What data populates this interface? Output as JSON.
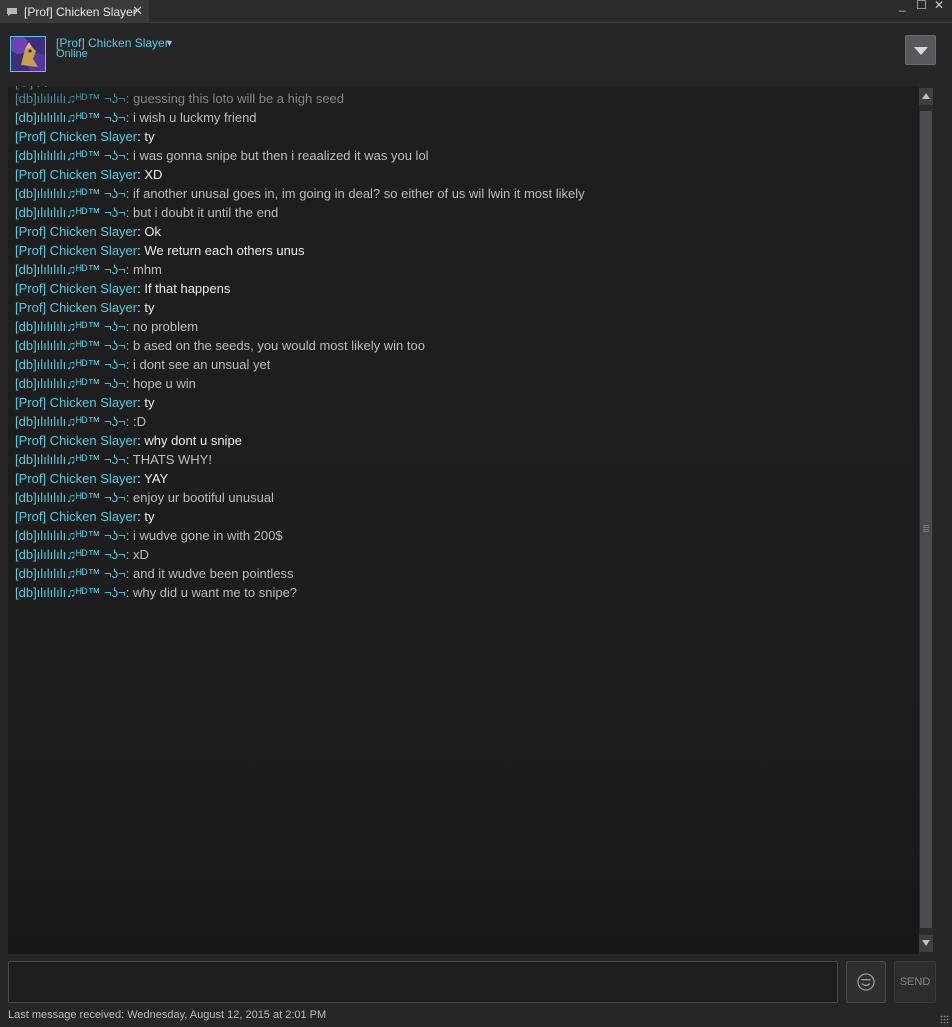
{
  "tab": {
    "title": "[Prof] Chicken Slayer",
    "close_glyph": "✕",
    "icon": "chat-bubble-icon"
  },
  "window_controls": {
    "minimize": "_",
    "maximize": "☐",
    "close": "✕"
  },
  "header": {
    "friend_name": "[Prof] Chicken Slayer",
    "status": "Online",
    "caret": "▼"
  },
  "colors": {
    "friend_name": "#57cbde",
    "my_text": "#ececec",
    "their_text": "#bdbdbd",
    "background": "#262627"
  },
  "chat": {
    "partial_top": "[ . ] .   .",
    "messages": [
      {
        "sender": "[db]ılılılılı♫ᴴᴰ™ ¬ʖ¬",
        "text": "guessing this loto will be a high seed",
        "self": false,
        "faded": true
      },
      {
        "sender": "[db]ılılılılı♫ᴴᴰ™ ¬ʖ¬",
        "text": "i wish u luckmy friend",
        "self": false
      },
      {
        "sender": "[Prof] Chicken Slayer",
        "text": "ty",
        "self": true
      },
      {
        "sender": "[db]ılılılılı♫ᴴᴰ™ ¬ʖ¬",
        "text": "i was gonna snipe but then i reaalized it was you lol",
        "self": false
      },
      {
        "sender": "[Prof] Chicken Slayer",
        "text": "XD",
        "self": true
      },
      {
        "sender": "[db]ılılılılı♫ᴴᴰ™ ¬ʖ¬",
        "text": "if another unusal goes in, im going in  deal? so either of us wil lwin it most likely",
        "self": false
      },
      {
        "sender": "[db]ılılılılı♫ᴴᴰ™ ¬ʖ¬",
        "text": "but i doubt it until the end",
        "self": false
      },
      {
        "sender": "[Prof] Chicken Slayer",
        "text": "Ok",
        "self": true
      },
      {
        "sender": "[Prof] Chicken Slayer",
        "text": "We return each others unus",
        "self": true
      },
      {
        "sender": "[db]ılılılılı♫ᴴᴰ™ ¬ʖ¬",
        "text": "mhm",
        "self": false
      },
      {
        "sender": "[Prof] Chicken Slayer",
        "text": "If that happens",
        "self": true
      },
      {
        "sender": "[Prof] Chicken Slayer",
        "text": "ty",
        "self": true
      },
      {
        "sender": "[db]ılılılılı♫ᴴᴰ™ ¬ʖ¬",
        "text": "no problem",
        "self": false
      },
      {
        "sender": "[db]ılılılılı♫ᴴᴰ™ ¬ʖ¬",
        "text": "b ased on the seeds, you would most likely win too",
        "self": false
      },
      {
        "sender": "[db]ılılılılı♫ᴴᴰ™ ¬ʖ¬",
        "text": "i dont see an unsual yet",
        "self": false
      },
      {
        "sender": "[db]ılılılılı♫ᴴᴰ™ ¬ʖ¬",
        "text": "hope u win",
        "self": false
      },
      {
        "sender": "[Prof] Chicken Slayer",
        "text": "ty",
        "self": true
      },
      {
        "sender": "[db]ılılılılı♫ᴴᴰ™ ¬ʖ¬",
        "text": ":D",
        "self": false
      },
      {
        "sender": "[Prof] Chicken Slayer",
        "text": "why dont u snipe",
        "self": true
      },
      {
        "sender": "[db]ılılılılı♫ᴴᴰ™ ¬ʖ¬",
        "text": "THATS WHY!",
        "self": false
      },
      {
        "sender": "[Prof] Chicken Slayer",
        "text": "YAY",
        "self": true
      },
      {
        "sender": "[db]ılılılılı♫ᴴᴰ™ ¬ʖ¬",
        "text": "enjoy ur bootiful unusual",
        "self": false
      },
      {
        "sender": "[Prof] Chicken Slayer",
        "text": "ty",
        "self": true
      },
      {
        "sender": "[db]ılılılılı♫ᴴᴰ™ ¬ʖ¬",
        "text": "i wudve gone in with 200$",
        "self": false
      },
      {
        "sender": "[db]ılılılılı♫ᴴᴰ™ ¬ʖ¬",
        "text": "xD",
        "self": false
      },
      {
        "sender": "[db]ılılılılı♫ᴴᴰ™ ¬ʖ¬",
        "text": "and it wudve been pointless",
        "self": false
      },
      {
        "sender": "[db]ılılılılı♫ᴴᴰ™ ¬ʖ¬",
        "text": "why did u want me to snipe?",
        "self": false
      }
    ]
  },
  "input": {
    "value": "",
    "placeholder": ""
  },
  "emoticon_button": {
    "icon": "smiley-icon"
  },
  "send_button": {
    "label": "SEND"
  },
  "footer": {
    "last_received": "Last message received: Wednesday, August 12, 2015 at 2:01 PM"
  }
}
